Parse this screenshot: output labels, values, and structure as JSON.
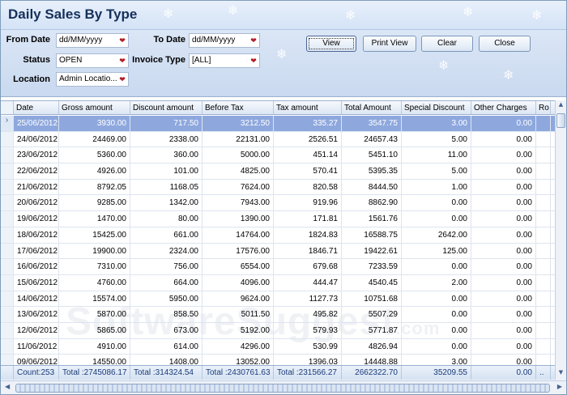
{
  "window": {
    "title": "Daily Sales By Type"
  },
  "filters": {
    "from_date_label": "From Date",
    "from_date_value": "dd/MM/yyyy",
    "to_date_label": "To Date",
    "to_date_value": "dd/MM/yyyy",
    "status_label": "Status",
    "status_value": "OPEN",
    "invoice_type_label": "Invoice Type",
    "invoice_type_value": "[ALL]",
    "location_label": "Location",
    "location_value": "Admin Locatio...",
    "dropdown_icon": "chevron-down-icon"
  },
  "buttons": {
    "view": "View",
    "print_view": "Print View",
    "clear": "Clear",
    "close": "Close"
  },
  "grid": {
    "columns": [
      "Date",
      "Gross amount",
      "Discount amount",
      "Before Tax",
      "Tax amount",
      "Total Amount",
      "Special Discount",
      "Other Charges",
      "Ro"
    ],
    "rows": [
      [
        "25/06/2012",
        "3930.00",
        "717.50",
        "3212.50",
        "335.27",
        "3547.75",
        "3.00",
        "0.00"
      ],
      [
        "24/06/2012",
        "24469.00",
        "2338.00",
        "22131.00",
        "2526.51",
        "24657.43",
        "5.00",
        "0.00"
      ],
      [
        "23/06/2012",
        "5360.00",
        "360.00",
        "5000.00",
        "451.14",
        "5451.10",
        "11.00",
        "0.00"
      ],
      [
        "22/06/2012",
        "4926.00",
        "101.00",
        "4825.00",
        "570.41",
        "5395.35",
        "5.00",
        "0.00"
      ],
      [
        "21/06/2012",
        "8792.05",
        "1168.05",
        "7624.00",
        "820.58",
        "8444.50",
        "1.00",
        "0.00"
      ],
      [
        "20/06/2012",
        "9285.00",
        "1342.00",
        "7943.00",
        "919.96",
        "8862.90",
        "0.00",
        "0.00"
      ],
      [
        "19/06/2012",
        "1470.00",
        "80.00",
        "1390.00",
        "171.81",
        "1561.76",
        "0.00",
        "0.00"
      ],
      [
        "18/06/2012",
        "15425.00",
        "661.00",
        "14764.00",
        "1824.83",
        "16588.75",
        "2642.00",
        "0.00"
      ],
      [
        "17/06/2012",
        "19900.00",
        "2324.00",
        "17576.00",
        "1846.71",
        "19422.61",
        "125.00",
        "0.00"
      ],
      [
        "16/06/2012",
        "7310.00",
        "756.00",
        "6554.00",
        "679.68",
        "7233.59",
        "0.00",
        "0.00"
      ],
      [
        "15/06/2012",
        "4760.00",
        "664.00",
        "4096.00",
        "444.47",
        "4540.45",
        "2.00",
        "0.00"
      ],
      [
        "14/06/2012",
        "15574.00",
        "5950.00",
        "9624.00",
        "1127.73",
        "10751.68",
        "0.00",
        "0.00"
      ],
      [
        "13/06/2012",
        "5870.00",
        "858.50",
        "5011.50",
        "495.82",
        "5507.29",
        "0.00",
        "0.00"
      ],
      [
        "12/06/2012",
        "5865.00",
        "673.00",
        "5192.00",
        "579.93",
        "5771.87",
        "0.00",
        "0.00"
      ],
      [
        "11/06/2012",
        "4910.00",
        "614.00",
        "4296.00",
        "530.99",
        "4826.94",
        "0.00",
        "0.00"
      ],
      [
        "09/06/2012",
        "14550.00",
        "1408.00",
        "13052.00",
        "1396.03",
        "14448.88",
        "3.00",
        "0.00"
      ]
    ],
    "footer": [
      "Count:253",
      "Total :2745086.17",
      "Total :314324.54",
      "Total :2430761.63",
      "Total :231566.27",
      "2662322.70",
      "35209.55",
      "0.00",
      ".."
    ],
    "row_indicator": "›"
  },
  "watermark": {
    "text": "SoftwareSuggest",
    "suffix": ".com"
  }
}
